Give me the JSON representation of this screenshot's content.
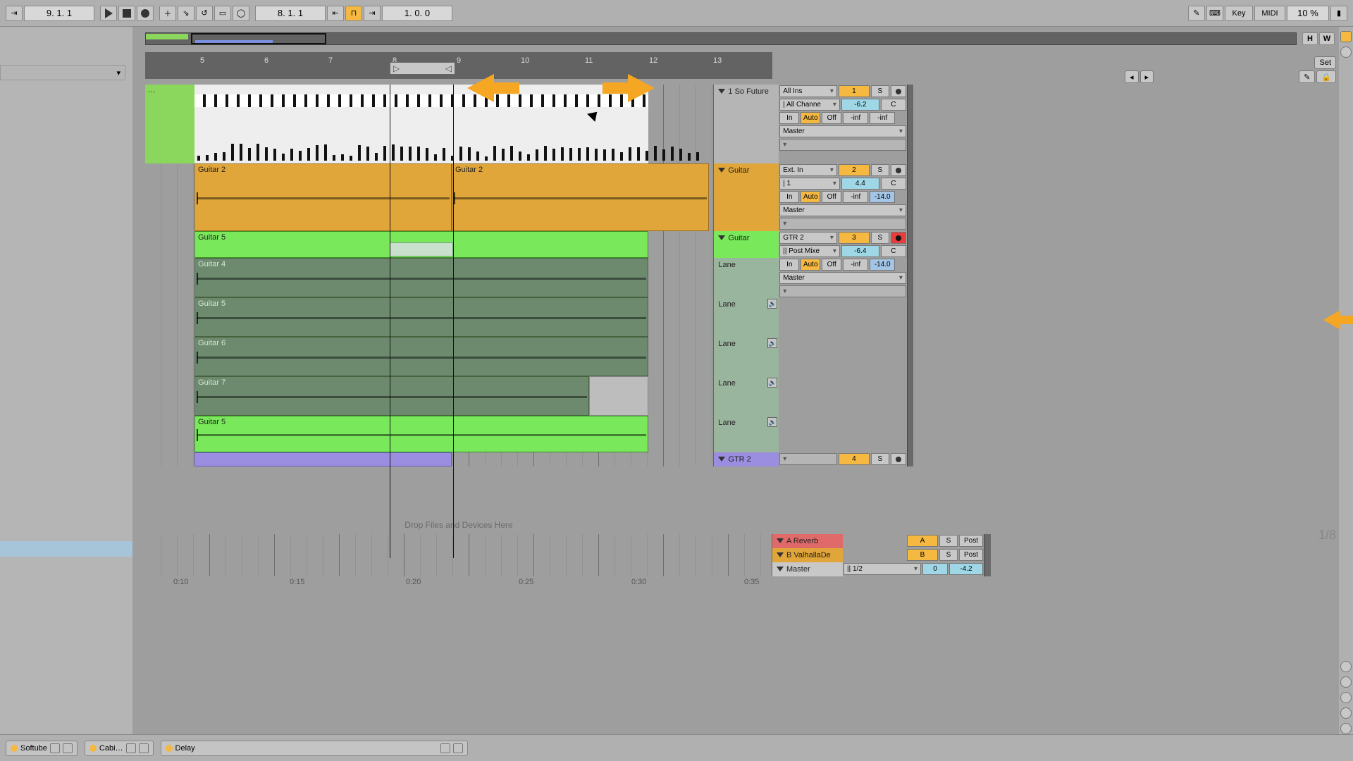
{
  "transport": {
    "pos": "9.  1.  1",
    "loop_pos": "8.  1.  1",
    "loop_len": "1.  0.  0",
    "zoom": "10 %",
    "key_label": "Key",
    "midi_label": "MIDI"
  },
  "overview": {
    "h_label": "H",
    "w_label": "W"
  },
  "ruler": {
    "bars": [
      "5",
      "6",
      "7",
      "8",
      "9",
      "10",
      "11",
      "12",
      "13"
    ]
  },
  "set": {
    "set_label": "Set"
  },
  "time_ruler": {
    "marks": [
      "0:10",
      "0:15",
      "0:20",
      "0:25",
      "0:30",
      "0:35"
    ],
    "grid": "1/8"
  },
  "tracks": {
    "midi": {
      "name": "1 So Future",
      "clip": "…",
      "input": "All Ins",
      "chan": "| All Channe",
      "num": "1",
      "db": "-6.2",
      "pan": "C",
      "io_in": "In",
      "io_auto": "Auto",
      "io_off": "Off",
      "s1": "-inf",
      "s2": "-inf",
      "out": "Master"
    },
    "guitar_a": {
      "name": "Guitar",
      "clip1": "Guitar 2",
      "clip2": "Guitar 2",
      "input": "Ext. In",
      "chan": "| 1",
      "num": "2",
      "db": "4.4",
      "pan": "C",
      "io_in": "In",
      "io_auto": "Auto",
      "io_off": "Off",
      "s1": "-inf",
      "s2": "-14.0",
      "out": "Master"
    },
    "guitar_b": {
      "name": "Guitar",
      "input": "GTR 2",
      "chan": "|| Post Mixe",
      "num": "3",
      "db": "-6.4",
      "pan": "C",
      "io_in": "In",
      "io_auto": "Auto",
      "io_off": "Off",
      "s1": "-inf",
      "s2": "-14.0",
      "out": "Master",
      "take_active": "Guitar 5",
      "takes": [
        "Guitar 4",
        "Guitar 5",
        "Guitar 6",
        "Guitar 7",
        "Guitar 5"
      ],
      "lane": "Lane"
    },
    "gtr2_grp": {
      "name": "GTR 2",
      "num": "4"
    },
    "ret_a": {
      "name": "A Reverb",
      "num": "A",
      "post": "Post"
    },
    "ret_b": {
      "name": "B ValhallaDe",
      "num": "B",
      "post": "Post"
    },
    "master": {
      "name": "Master",
      "sig": "|| 1/2",
      "num": "0",
      "db": "-4.2"
    }
  },
  "solo": "S",
  "dropzone": "Drop Files and Devices Here",
  "devices": {
    "d1": "Softube",
    "d2": "Cabi…",
    "d3": "Delay"
  }
}
